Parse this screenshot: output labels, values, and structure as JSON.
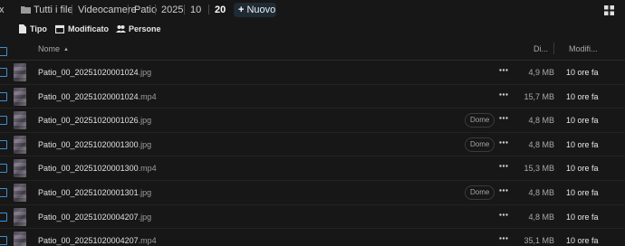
{
  "topbar": {
    "edge_glyph": "x",
    "breadcrumbs": [
      "Tutti i file",
      "Videocamere",
      "Patio",
      "2025",
      "10",
      "20"
    ],
    "new_button_label": "Nuovo",
    "new_button_icon": "plus-icon",
    "view_toggle_icon": "grid-view-icon"
  },
  "filters": [
    {
      "label": "Tipo",
      "icon": "document-icon"
    },
    {
      "label": "Modificato",
      "icon": "calendar-icon"
    },
    {
      "label": "Persone",
      "icon": "people-icon"
    }
  ],
  "table": {
    "headers": {
      "name": "Nome",
      "size": "Di...",
      "modified": "Modifi..."
    },
    "sort_indicator": "▲",
    "rows": [
      {
        "base": "Patio_00_20251020001024",
        "ext": ".jpg",
        "tag": "",
        "size": "4,9 MB",
        "modified": "10 ore fa"
      },
      {
        "base": "Patio_00_20251020001024",
        "ext": ".mp4",
        "tag": "",
        "size": "15,7 MB",
        "modified": "10 ore fa"
      },
      {
        "base": "Patio_00_20251020001026",
        "ext": ".jpg",
        "tag": "Dome",
        "size": "4,8 MB",
        "modified": "10 ore fa"
      },
      {
        "base": "Patio_00_20251020001300",
        "ext": ".jpg",
        "tag": "Dome",
        "size": "4,8 MB",
        "modified": "10 ore fa"
      },
      {
        "base": "Patio_00_20251020001300",
        "ext": ".mp4",
        "tag": "",
        "size": "15,3 MB",
        "modified": "10 ore fa"
      },
      {
        "base": "Patio_00_20251020001301",
        "ext": ".jpg",
        "tag": "Dome",
        "size": "4,8 MB",
        "modified": "10 ore fa"
      },
      {
        "base": "Patio_00_20251020004207",
        "ext": ".jpg",
        "tag": "",
        "size": "4,8 MB",
        "modified": "10 ore fa"
      },
      {
        "base": "Patio_00_20251020004207",
        "ext": ".mp4",
        "tag": "",
        "size": "35,1 MB",
        "modified": "10 ore fa"
      }
    ]
  },
  "colors": {
    "accent": "#3d8fd1",
    "background": "#171717"
  }
}
